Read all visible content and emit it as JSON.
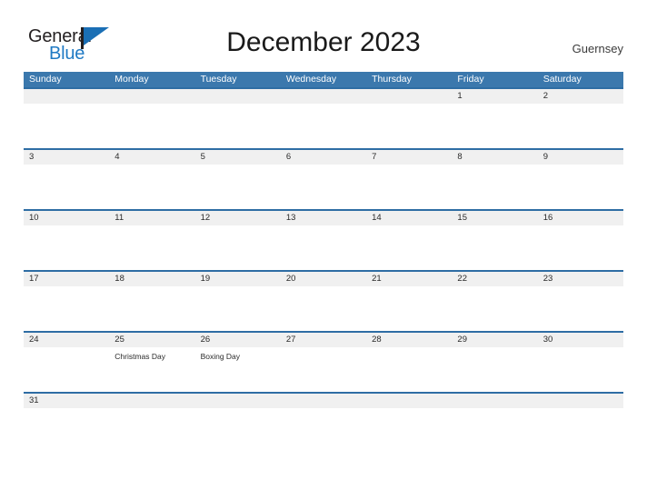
{
  "logo": {
    "word_one": "General",
    "word_two": "Blue",
    "flag_icon": "flag-triangle-icon"
  },
  "header": {
    "title": "December 2023",
    "region": "Guernsey"
  },
  "colors": {
    "header_band": "#3b78ad",
    "week_separator": "#2e6da4",
    "day_band": "#f0f0f0",
    "logo_blue": "#1f7ac4",
    "text": "#2a2a2a"
  },
  "calendar": {
    "weekday_headers": [
      "Sunday",
      "Monday",
      "Tuesday",
      "Wednesday",
      "Thursday",
      "Friday",
      "Saturday"
    ],
    "weeks": [
      [
        {
          "day": "",
          "event": ""
        },
        {
          "day": "",
          "event": ""
        },
        {
          "day": "",
          "event": ""
        },
        {
          "day": "",
          "event": ""
        },
        {
          "day": "",
          "event": ""
        },
        {
          "day": "1",
          "event": ""
        },
        {
          "day": "2",
          "event": ""
        }
      ],
      [
        {
          "day": "3",
          "event": ""
        },
        {
          "day": "4",
          "event": ""
        },
        {
          "day": "5",
          "event": ""
        },
        {
          "day": "6",
          "event": ""
        },
        {
          "day": "7",
          "event": ""
        },
        {
          "day": "8",
          "event": ""
        },
        {
          "day": "9",
          "event": ""
        }
      ],
      [
        {
          "day": "10",
          "event": ""
        },
        {
          "day": "11",
          "event": ""
        },
        {
          "day": "12",
          "event": ""
        },
        {
          "day": "13",
          "event": ""
        },
        {
          "day": "14",
          "event": ""
        },
        {
          "day": "15",
          "event": ""
        },
        {
          "day": "16",
          "event": ""
        }
      ],
      [
        {
          "day": "17",
          "event": ""
        },
        {
          "day": "18",
          "event": ""
        },
        {
          "day": "19",
          "event": ""
        },
        {
          "day": "20",
          "event": ""
        },
        {
          "day": "21",
          "event": ""
        },
        {
          "day": "22",
          "event": ""
        },
        {
          "day": "23",
          "event": ""
        }
      ],
      [
        {
          "day": "24",
          "event": ""
        },
        {
          "day": "25",
          "event": "Christmas Day"
        },
        {
          "day": "26",
          "event": "Boxing Day"
        },
        {
          "day": "27",
          "event": ""
        },
        {
          "day": "28",
          "event": ""
        },
        {
          "day": "29",
          "event": ""
        },
        {
          "day": "30",
          "event": ""
        }
      ],
      [
        {
          "day": "31",
          "event": ""
        },
        {
          "day": "",
          "event": ""
        },
        {
          "day": "",
          "event": ""
        },
        {
          "day": "",
          "event": ""
        },
        {
          "day": "",
          "event": ""
        },
        {
          "day": "",
          "event": ""
        },
        {
          "day": "",
          "event": ""
        }
      ]
    ]
  }
}
